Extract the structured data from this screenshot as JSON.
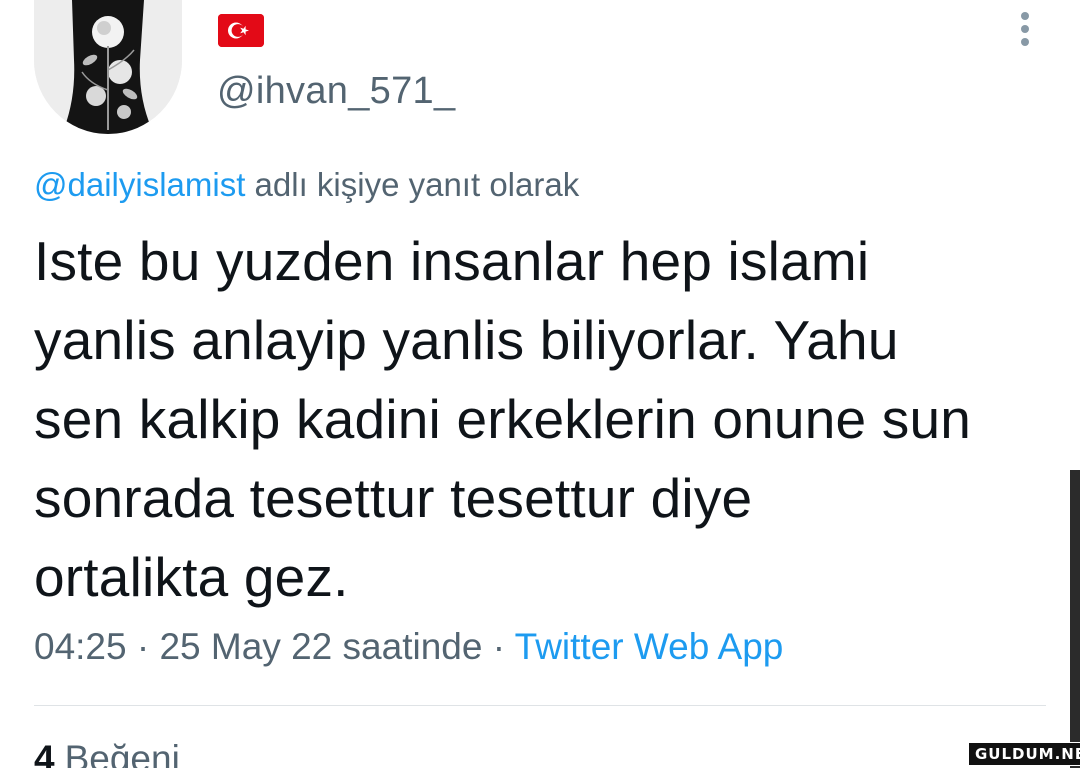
{
  "profile": {
    "flag_icon": "turkey-flag",
    "handle": "@ihvan_571_"
  },
  "reply": {
    "mention": "@dailyislamist",
    "suffix": "adlı kişiye yanıt olarak"
  },
  "tweet": {
    "text": "Iste bu yuzden insanlar hep islami\nyanlis anlayip yanlis biliyorlar. Yahu\nsen kalkip kadini erkeklerin onune sun\nsonrada tesettur tesettur diye\nortalikta gez."
  },
  "meta": {
    "time": "04:25",
    "separator": "·",
    "date": "25 May 22 saatinde",
    "source": "Twitter Web App"
  },
  "stats": {
    "likes_count": "4",
    "likes_label": "Beğeni"
  },
  "watermark": "GULDUM.NET",
  "colors": {
    "link": "#1d9bf0",
    "secondary_text": "#536471",
    "primary_text": "#0f1419",
    "flag_red": "#e30a17"
  }
}
